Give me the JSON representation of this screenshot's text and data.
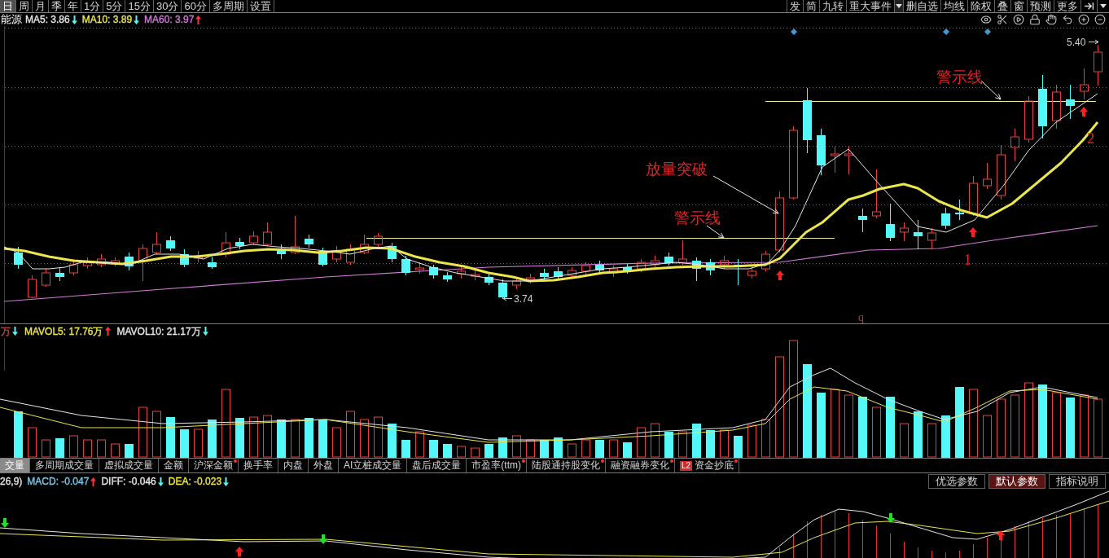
{
  "period_tabs": [
    {
      "label": "日",
      "selected": true
    },
    {
      "label": "周",
      "selected": false
    },
    {
      "label": "月",
      "selected": false
    },
    {
      "label": "季",
      "selected": false
    },
    {
      "label": "年",
      "selected": false
    },
    {
      "label": "1分",
      "selected": false
    },
    {
      "label": "5分",
      "selected": false
    },
    {
      "label": "15分",
      "selected": false
    },
    {
      "label": "30分",
      "selected": false
    },
    {
      "label": "60分",
      "selected": false
    },
    {
      "label": "多周期",
      "selected": false
    },
    {
      "label": "设置",
      "selected": false
    }
  ],
  "toolbar_left": [
    "发",
    "简",
    "九转",
    "重大事件"
  ],
  "toolbar_right": [
    "删自选",
    "均线",
    "除权",
    "叠",
    "窗",
    "预测",
    "更多"
  ],
  "price_legend": {
    "title": "能源",
    "indicators": [
      {
        "label": "MA5: 3.86",
        "color": "#e6e6e6",
        "rising": false
      },
      {
        "label": "MA10: 3.89",
        "color": "#ece64c",
        "rising": false
      },
      {
        "label": "MA60: 3.97",
        "color": "#d27ad8",
        "rising": true
      }
    ]
  },
  "price_chart": {
    "price_marks": [
      "5.40",
      "3.74"
    ],
    "annotations": [
      "放量突破",
      "警示线",
      "警示线",
      "1",
      "2",
      "q"
    ]
  },
  "volume_legend": {
    "indicators": [
      {
        "label": "万",
        "color": "#c04a40",
        "rising": false
      },
      {
        "label": "MAVOL5: 17.76万",
        "color": "#ece64c",
        "rising": true
      },
      {
        "label": "MAVOL10: 21.17万",
        "color": "#e6e6e6",
        "rising": false
      }
    ]
  },
  "indicator_tabs": [
    {
      "label": "交量",
      "selected": true,
      "dot": false
    },
    {
      "label": "多周期成交量",
      "selected": false,
      "dot": false
    },
    {
      "label": "虚拟成交量",
      "selected": false,
      "dot": false
    },
    {
      "label": "金额",
      "selected": false,
      "dot": false
    },
    {
      "label": "沪深金额",
      "selected": false,
      "dot": true
    },
    {
      "label": "换手率",
      "selected": false,
      "dot": false
    },
    {
      "label": "内盘",
      "selected": false,
      "dot": false
    },
    {
      "label": "外盘",
      "selected": false,
      "dot": false
    },
    {
      "label": "AI立桩成交量",
      "selected": false,
      "dot": false
    },
    {
      "label": "盘后成交量",
      "selected": false,
      "dot": false
    },
    {
      "label": "市盈率(ttm)",
      "selected": false,
      "dot": true
    },
    {
      "label": "陆股通持股变化",
      "selected": false,
      "dot": true
    },
    {
      "label": "融资融券变化",
      "selected": false,
      "dot": true
    },
    {
      "label": "资金抄底",
      "badge": "L2",
      "selected": false,
      "dot": true
    }
  ],
  "macd_legend": {
    "indicators": [
      {
        "label": "26,9)",
        "color": "#e6e6e6"
      },
      {
        "label": "MACD: -0.047",
        "color": "#7cc8e8",
        "rising": true
      },
      {
        "label": "DIFF: -0.046",
        "color": "#e6e6e6",
        "rising": false
      },
      {
        "label": "DEA: -0.023",
        "color": "#ece64c",
        "rising": false
      }
    ]
  },
  "param_buttons": [
    {
      "label": "优选参数",
      "selected": false
    },
    {
      "label": "默认参数",
      "selected": true
    },
    {
      "label": "指标说明",
      "selected": false
    }
  ]
}
